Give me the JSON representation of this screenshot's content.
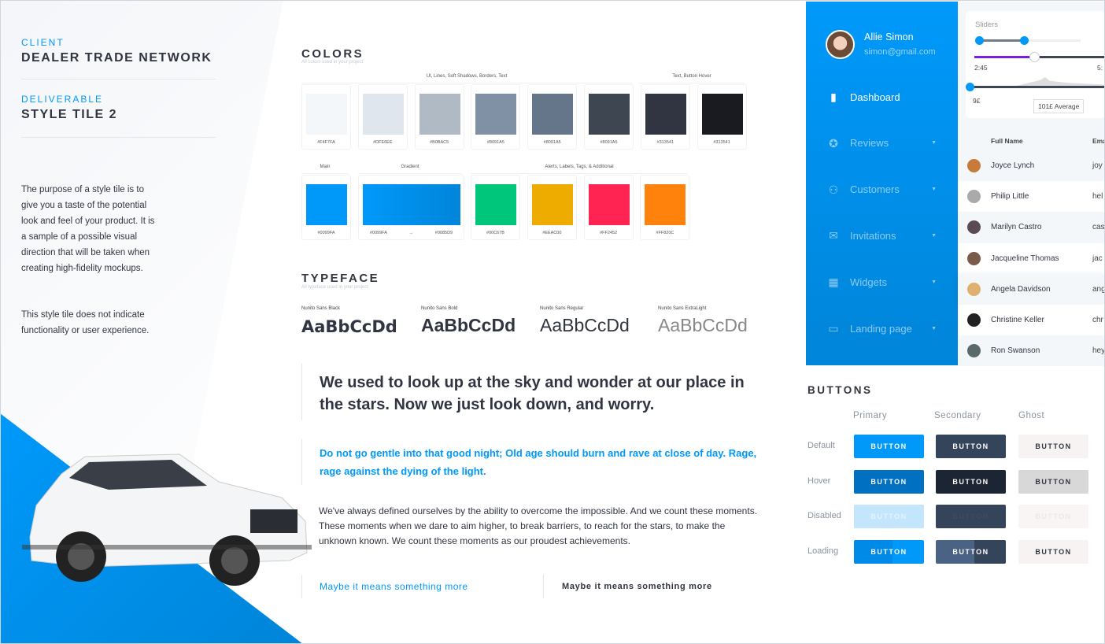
{
  "left": {
    "client_label": "CLIENT",
    "client": "DEALER TRADE NETWORK",
    "deliverable_label": "DELIVERABLE",
    "deliverable": "STYLE TILE 2",
    "desc1": "The purpose of a style tile is to give you a taste of the potential look and feel of your product. It is a sample of a possible visual direction that will be taken when creating high-fidelity mockups.",
    "desc2": "This style tile does not indicate functionality or user experience."
  },
  "colors": {
    "title": "COLORS",
    "subtitle": "All colors used in your project",
    "group1": "UI, Lines, Soft Shadows, Borders, Text",
    "group2": "Text, Button Hover",
    "group3": "Main",
    "group4": "Gradient",
    "group5": "Alerts, Labels, Tags, & Additional",
    "row1": [
      {
        "hex": "#F4F7FA",
        "color": "#f4f7fa"
      },
      {
        "hex": "#DFE6EE",
        "color": "#dfe6ee"
      },
      {
        "hex": "#B0BAC5",
        "color": "#b0bac5"
      },
      {
        "hex": "#8091A5",
        "color": "#8091a5"
      },
      {
        "hex": "#8091A5",
        "color": "#66768a"
      },
      {
        "hex": "#8091A5",
        "color": "#3d4651"
      },
      {
        "hex": "#313541",
        "color": "#313541"
      },
      {
        "hex": "#313541",
        "color": "#1a1b20"
      }
    ],
    "main": {
      "hex": "#0099FA",
      "color": "#0099fa"
    },
    "gradient": {
      "from": "#0099FA",
      "arrow": "→",
      "to": "#0085D9"
    },
    "row2": [
      {
        "hex": "#00C67B",
        "color": "#00c67b"
      },
      {
        "hex": "#EEAC00",
        "color": "#eeac00"
      },
      {
        "hex": "#FF2452",
        "color": "#ff2452"
      },
      {
        "hex": "#FF820C",
        "color": "#ff820c"
      }
    ]
  },
  "typeface": {
    "title": "TYPEFACE",
    "subtitle": "All typeface used in your project",
    "fonts": [
      {
        "name": "Nunito Sans Black",
        "sample": "AaBbCcDd"
      },
      {
        "name": "Nunito Sans Bold",
        "sample": "AaBbCcDd"
      },
      {
        "name": "Nunito Sans Regular",
        "sample": "AaBbCcDd"
      },
      {
        "name": "Nunito Sans ExtraLight",
        "sample": "AaBbCcDd"
      }
    ]
  },
  "text": {
    "heading": "We used to look up at the sky and wonder at our place in the stars. Now we just look down, and worry.",
    "accent": "Do not go gentle into that good night; Old age should burn and rave at close of day. Rage, rage against the dying of the light.",
    "body": "We've always defined ourselves by the ability to overcome the impossible. And we count these moments. These moments when we dare to aim higher, to break barriers, to reach for the stars, to make the unknown known. We count these moments as our proudest achievements.",
    "link1": "Maybe it means something more",
    "link2": "Maybe it means something more"
  },
  "sidebar": {
    "user": "Allie Simon",
    "email": "simon@gmail.com",
    "items": [
      {
        "label": "Dashboard",
        "icon": "bar-chart-icon"
      },
      {
        "label": "Reviews",
        "icon": "chat-star-icon"
      },
      {
        "label": "Customers",
        "icon": "users-icon"
      },
      {
        "label": "Invitations",
        "icon": "envelope-open-icon"
      },
      {
        "label": "Widgets",
        "icon": "widgets-icon"
      },
      {
        "label": "Landing page",
        "icon": "browser-window-icon"
      }
    ]
  },
  "sliders": {
    "title": "Sliders",
    "time_start": "2:45",
    "time_end": "5:",
    "price_min": "9£",
    "tooltip": "101£ Average",
    "range_slider": [
      0,
      30
    ],
    "media_progress": 0.4
  },
  "table": {
    "col_name": "Full Name",
    "col_email": "Ema",
    "rows": [
      {
        "name": "Joyce Lynch",
        "email": "joy"
      },
      {
        "name": "Philip Little",
        "email": "hel"
      },
      {
        "name": "Marilyn Castro",
        "email": "cas"
      },
      {
        "name": "Jacqueline Thomas",
        "email": "jac"
      },
      {
        "name": "Angela Davidson",
        "email": "ang"
      },
      {
        "name": "Christine Keller",
        "email": "chr"
      },
      {
        "name": "Ron Swanson",
        "email": "hey"
      }
    ]
  },
  "buttons": {
    "title": "BUTTONS",
    "cols": [
      "Primary",
      "Secondary",
      "Ghost"
    ],
    "rows": [
      "Default",
      "Hover",
      "Disabled",
      "Loading"
    ],
    "label": "BUTTON"
  }
}
